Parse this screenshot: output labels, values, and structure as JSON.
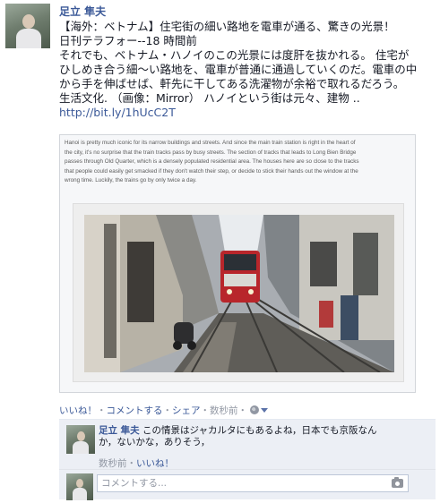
{
  "post": {
    "author": "足立 隼夫",
    "lines": [
      "【海外：ベトナム】住宅街の細い路地を電車が通る、驚きの光景！",
      "日刊テラフォー--18 時間前",
      "それでも、ベトナム・ハノイのこの光景には度肝を抜かれる。 住宅が",
      "ひしめき合う細〜い路地を、電車が普通に通過していくのだ。電車の中",
      "から手を伸ばせば、軒先に干してある洗濯物が余裕で取れるだろう。",
      "生活文化. （画像：Mirror） ハノイという街は元々、建物 .."
    ],
    "link": "http://bit.ly/1hUcC2T"
  },
  "card": {
    "caption_lines": [
      "Hanoi is pretty much iconic for its narrow buildings and streets. And since the main train station is right in the heart of",
      "the city, it's no surprise that the train tracks pass by busy streets. The section of tracks that leads to Long Bien Bridge",
      "passes through Old Quarter, which is a densely populated residential area. The houses here are so close to the tracks",
      "that people could easily get smacked if they don't watch their step, or decide to stick their hands out the window at the",
      "wrong time. Luckily, the trains go by only twice a day."
    ]
  },
  "actions": {
    "like": "いいね！",
    "comment": "コメントする",
    "share": "シェア",
    "time": "数秒前",
    "sep": "・"
  },
  "comment": {
    "author": "足立 隼夫",
    "text_line1": "この情景はジャカルタにもあるよね，日本でも京阪なん",
    "text_line2": "か，ないかな，ありそう，",
    "time": "数秒前",
    "sep": "・",
    "like": "いいね！"
  },
  "reply": {
    "placeholder": "コメントする..."
  },
  "colors": {
    "link": "#3b5998",
    "meta": "#9197a3",
    "comment_bg": "#eceff5"
  }
}
